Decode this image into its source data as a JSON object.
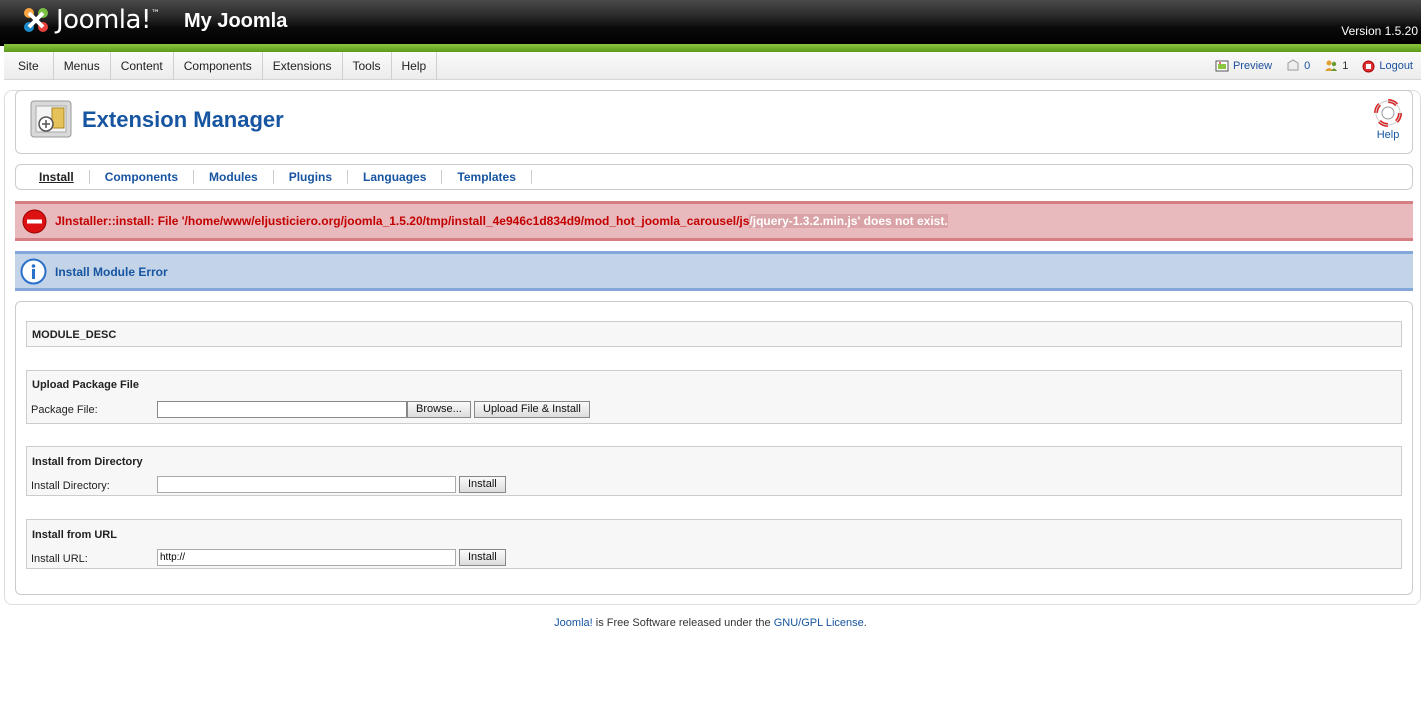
{
  "header": {
    "logo_text": "Joomla!",
    "site_title": "My Joomla",
    "version": "Version 1.5.20"
  },
  "menubar": {
    "items": [
      "Site",
      "Menus",
      "Content",
      "Components",
      "Extensions",
      "Tools",
      "Help"
    ],
    "status": {
      "preview": "Preview",
      "messages": "0",
      "users": "1",
      "logout": "Logout"
    }
  },
  "toolbar": {
    "title": "Extension Manager",
    "help": "Help"
  },
  "submenu": {
    "items": [
      "Install",
      "Components",
      "Modules",
      "Plugins",
      "Languages",
      "Templates"
    ]
  },
  "messages": {
    "error_main": "JInstaller::install: File '/home/www/eljusticiero.org/joomla_1.5.20/tmp/install_4e946c1d834d9/mod_hot_joomla_carousel/js",
    "error_tail": "/jquery-1.3.2.min.js' does not exist.",
    "info": "Install Module Error"
  },
  "main": {
    "module_desc": "MODULE_DESC",
    "upload": {
      "legend": "Upload Package File",
      "label": "Package File:",
      "browse": "Browse...",
      "submit": "Upload File & Install"
    },
    "directory": {
      "legend": "Install from Directory",
      "label": "Install Directory:",
      "value": "",
      "submit": "Install"
    },
    "url": {
      "legend": "Install from URL",
      "label": "Install URL:",
      "value": "http://",
      "submit": "Install"
    }
  },
  "footer": {
    "joomla_link": "Joomla!",
    "middle": " is Free Software released under the ",
    "license_link": "GNU/GPL License",
    "end": "."
  },
  "colors": {
    "brand_blue": "#1755a1",
    "error_red": "#c30000",
    "header_green": "#8cc63f"
  }
}
